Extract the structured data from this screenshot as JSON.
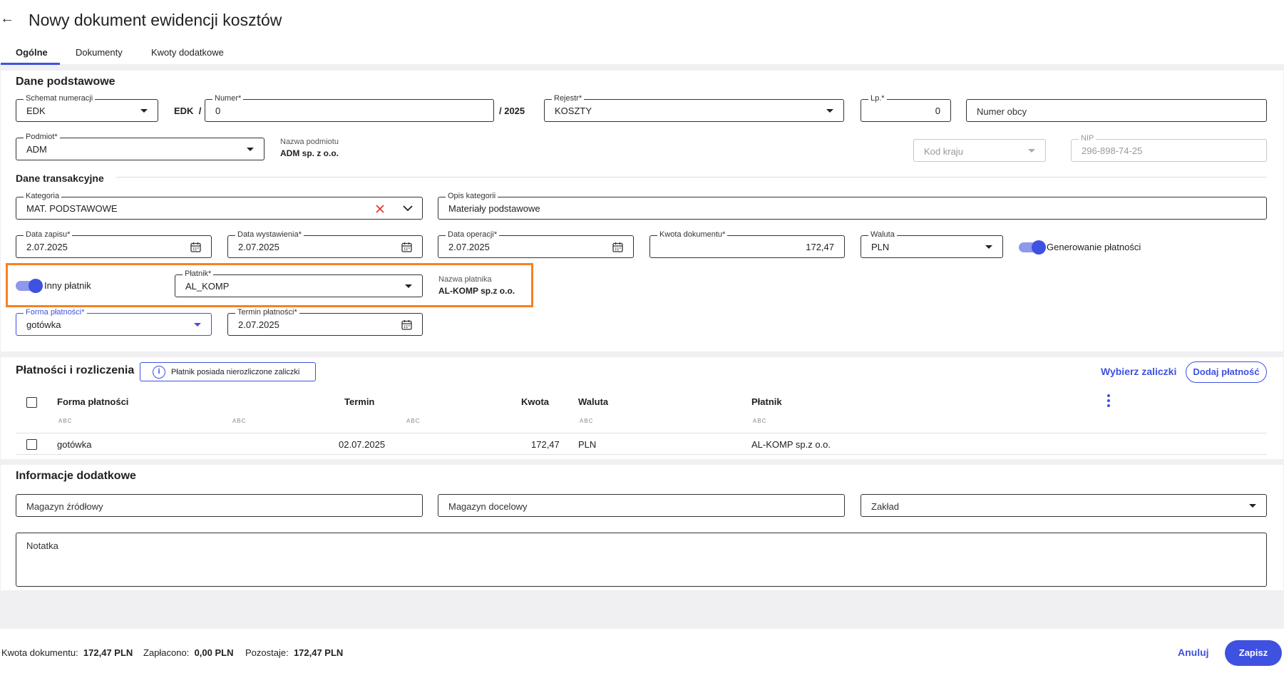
{
  "header": {
    "title": "Nowy dokument ewidencji kosztów",
    "tabs": [
      "Ogólne",
      "Dokumenty",
      "Kwoty dodatkowe"
    ]
  },
  "basic": {
    "section_title": "Dane podstawowe",
    "schemat_label": "Schemat numeracji",
    "schemat_value": "EDK",
    "prefix": "EDK",
    "slash": "/",
    "numer_label": "Numer*",
    "numer_value": "0",
    "year_suffix": "/ 2025",
    "rejestr_label": "Rejestr*",
    "rejestr_value": "KOSZTY",
    "lp_label": "Lp.*",
    "lp_value": "0",
    "numer_obcy_placeholder": "Numer obcy",
    "podmiot_label": "Podmiot*",
    "podmiot_value": "ADM",
    "nazwa_podmiotu_label": "Nazwa podmiotu",
    "nazwa_podmiotu_value": "ADM sp. z o.o.",
    "kod_kraju_placeholder": "Kod kraju",
    "nip_label": "NIP",
    "nip_value": "296-898-74-25"
  },
  "transaction": {
    "section_title": "Dane transakcyjne",
    "kategoria_label": "Kategoria",
    "kategoria_value": "MAT. PODSTAWOWE",
    "opis_label": "Opis kategorii",
    "opis_value": "Materiały podstawowe",
    "data_zapisu_label": "Data zapisu*",
    "data_zapisu_value": "2.07.2025",
    "data_wystawienia_label": "Data wystawienia*",
    "data_wystawienia_value": "2.07.2025",
    "data_operacji_label": "Data operacji*",
    "data_operacji_value": "2.07.2025",
    "kwota_label": "Kwota dokumentu*",
    "kwota_value": "172,47",
    "waluta_label": "Waluta",
    "waluta_value": "PLN",
    "generowanie_label": "Generowanie płatności",
    "inny_platnik_label": "Inny płatnik",
    "platnik_label": "Płatnik*",
    "platnik_value": "AL_KOMP",
    "nazwa_platnika_label": "Nazwa płatnika",
    "nazwa_platnika_value": "AL-KOMP sp.z o.o.",
    "forma_label": "Forma płatności*",
    "forma_value": "gotówka",
    "termin_label": "Termin płatności*",
    "termin_value": "2.07.2025"
  },
  "payments": {
    "section_title": "Płatności i rozliczenia",
    "info_text": "Płatnik posiada nierozliczone zaliczki",
    "wybierz_label": "Wybierz zaliczki",
    "dodaj_label": "Dodaj płatność",
    "columns": [
      "Forma płatności",
      "Termin",
      "Kwota",
      "Waluta",
      "Płatnik"
    ],
    "filter_glyph": "ABC",
    "rows": [
      {
        "forma": "gotówka",
        "termin": "02.07.2025",
        "kwota": "172,47",
        "waluta": "PLN",
        "platnik": "AL-KOMP sp.z o.o."
      }
    ]
  },
  "extra": {
    "section_title": "Informacje dodatkowe",
    "magazyn_zrodlowy": "Magazyn źródłowy",
    "magazyn_docelowy": "Magazyn docelowy",
    "zaklad": "Zakład",
    "notatka": "Notatka"
  },
  "footer": {
    "kwota_label": "Kwota dokumentu:",
    "kwota_value": "172,47 PLN",
    "zaplacono_label": "Zapłacono:",
    "zaplacono_value": "0,00 PLN",
    "pozostaje_label": "Pozostaje:",
    "pozostaje_value": "172,47 PLN",
    "anuluj": "Anuluj",
    "zapisz": "Zapisz"
  },
  "colors": {
    "accent": "#3f51e0",
    "highlight": "#f58220",
    "clear_icon": "#e53935"
  },
  "icons": {
    "back": "arrow-left-icon",
    "calendar": "calendar-icon",
    "info": "info-icon",
    "clear": "clear-x-icon",
    "kebab": "kebab-menu-icon"
  }
}
